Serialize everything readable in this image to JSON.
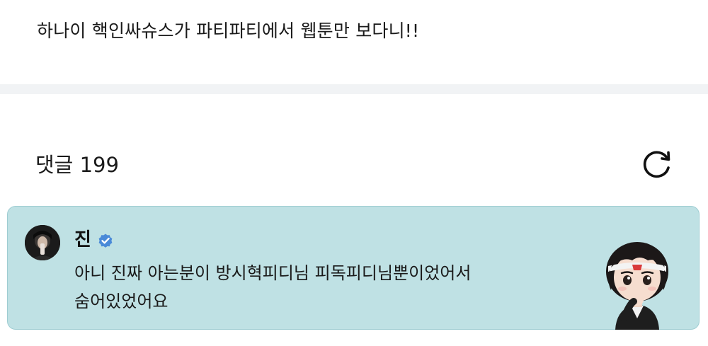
{
  "post": {
    "text": "하나이 핵인싸슈스가 파티파티에서 웹툰만 보다니!!"
  },
  "comments": {
    "title": "댓글 199",
    "refresh_icon": "refresh-icon"
  },
  "comment": {
    "author": "진",
    "verified_icon": "verified-badge-icon",
    "lines": [
      "아니 진짜 아는분이 방시혁피디님 피독피디님뿐이었어서",
      "숨어있었어요"
    ],
    "sticker": "character-sticker",
    "background_color": "#bfe1e4",
    "border_color": "#9fcdd2",
    "badge_color": "#4a8ad8"
  }
}
